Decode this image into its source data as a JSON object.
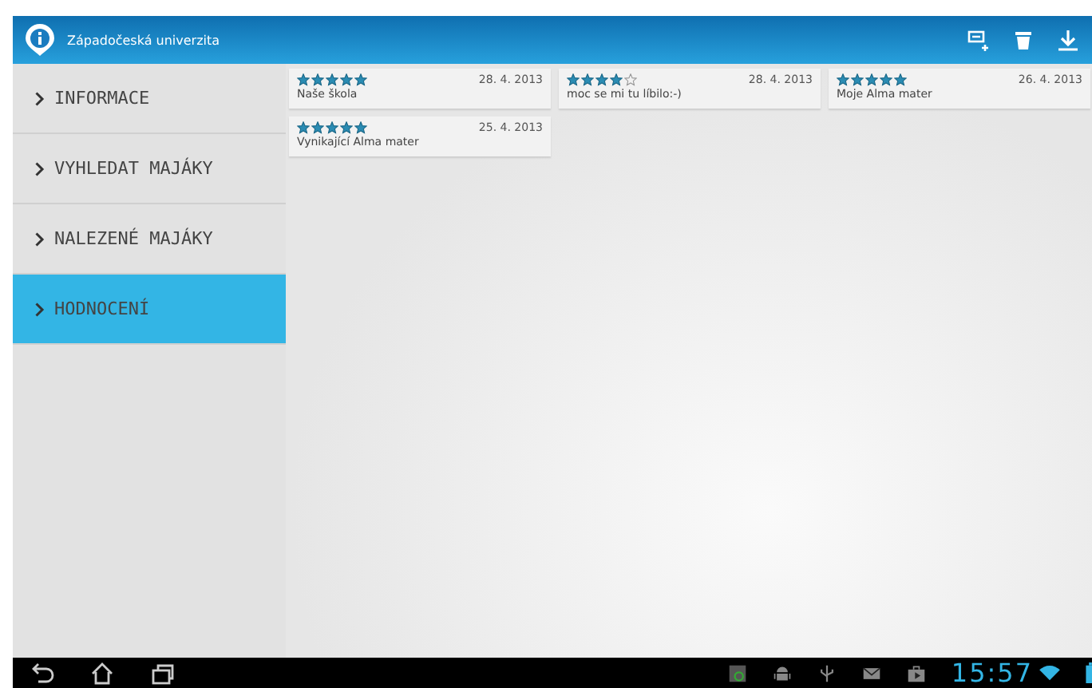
{
  "action_bar": {
    "title": "Západočeská univerzita"
  },
  "sidebar": {
    "items": [
      {
        "label": "INFORMACE",
        "selected": false
      },
      {
        "label": "VYHLEDAT MAJÁKY",
        "selected": false
      },
      {
        "label": "NALEZENÉ MAJÁKY",
        "selected": false
      },
      {
        "label": "HODNOCENÍ",
        "selected": true
      }
    ]
  },
  "reviews": [
    {
      "stars": 5,
      "date": "28. 4. 2013",
      "text": "Naše škola"
    },
    {
      "stars": 4,
      "date": "28. 4. 2013",
      "text": "moc se mi tu líbilo:-)"
    },
    {
      "stars": 5,
      "date": "26. 4. 2013",
      "text": "Moje Alma mater"
    },
    {
      "stars": 5,
      "date": "25. 4. 2013",
      "text": "Vynikající Alma mater"
    }
  ],
  "status_bar": {
    "time": "15:57"
  }
}
